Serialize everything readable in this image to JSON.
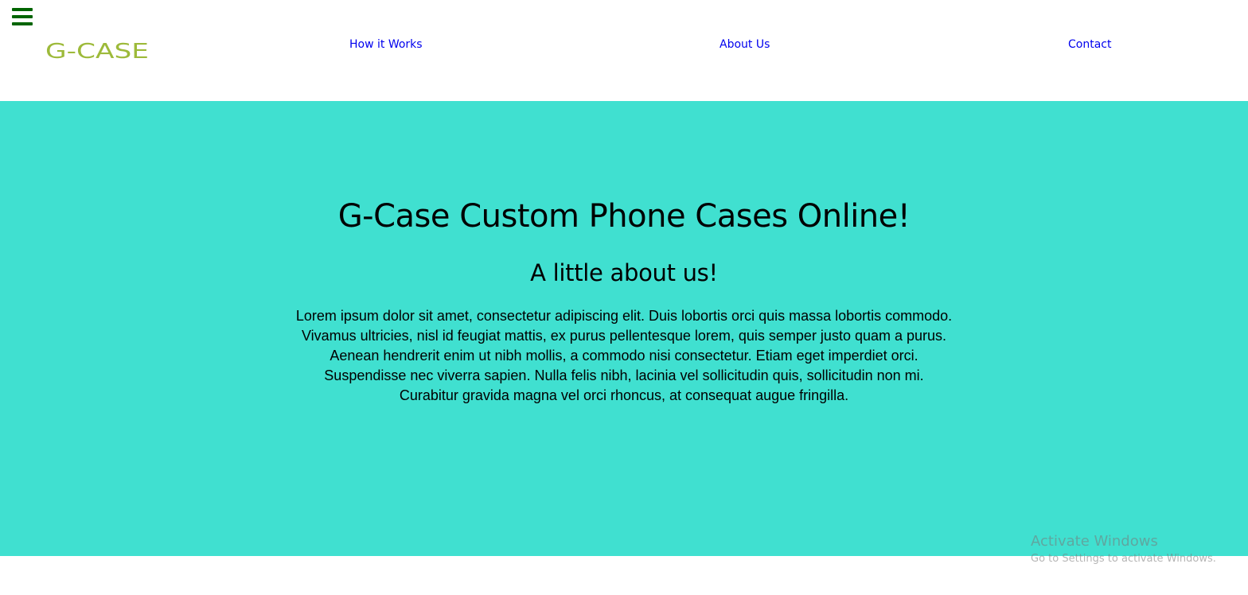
{
  "colors": {
    "hero_bg": "#40E0D0",
    "nav_link": "#0000EE",
    "hamburger": "#006400",
    "logo": "#9DBA3A"
  },
  "header": {
    "menu_icon": "hamburger-menu-icon",
    "logo_text": "G-CASE",
    "nav": [
      {
        "label": "How it Works"
      },
      {
        "label": "About Us"
      },
      {
        "label": "Contact"
      }
    ]
  },
  "hero": {
    "title": "G-Case Custom Phone Cases Online!",
    "subtitle": "A little about us!",
    "body_lines": [
      "Lorem ipsum dolor sit amet, consectetur adipiscing elit. Duis lobortis orci quis massa lobortis commodo.",
      "Vivamus ultricies, nisl id feugiat mattis, ex purus pellentesque lorem, quis semper justo quam a purus.",
      "Aenean hendrerit enim ut nibh mollis, a commodo nisi consectetur. Etiam eget imperdiet orci.",
      "Suspendisse nec viverra sapien. Nulla felis nibh, lacinia vel sollicitudin quis, sollicitudin non mi.",
      "Curabitur gravida magna vel orci rhoncus, at consequat augue fringilla."
    ]
  },
  "watermark": {
    "line1": "Activate Windows",
    "line2": "Go to Settings to activate Windows."
  }
}
